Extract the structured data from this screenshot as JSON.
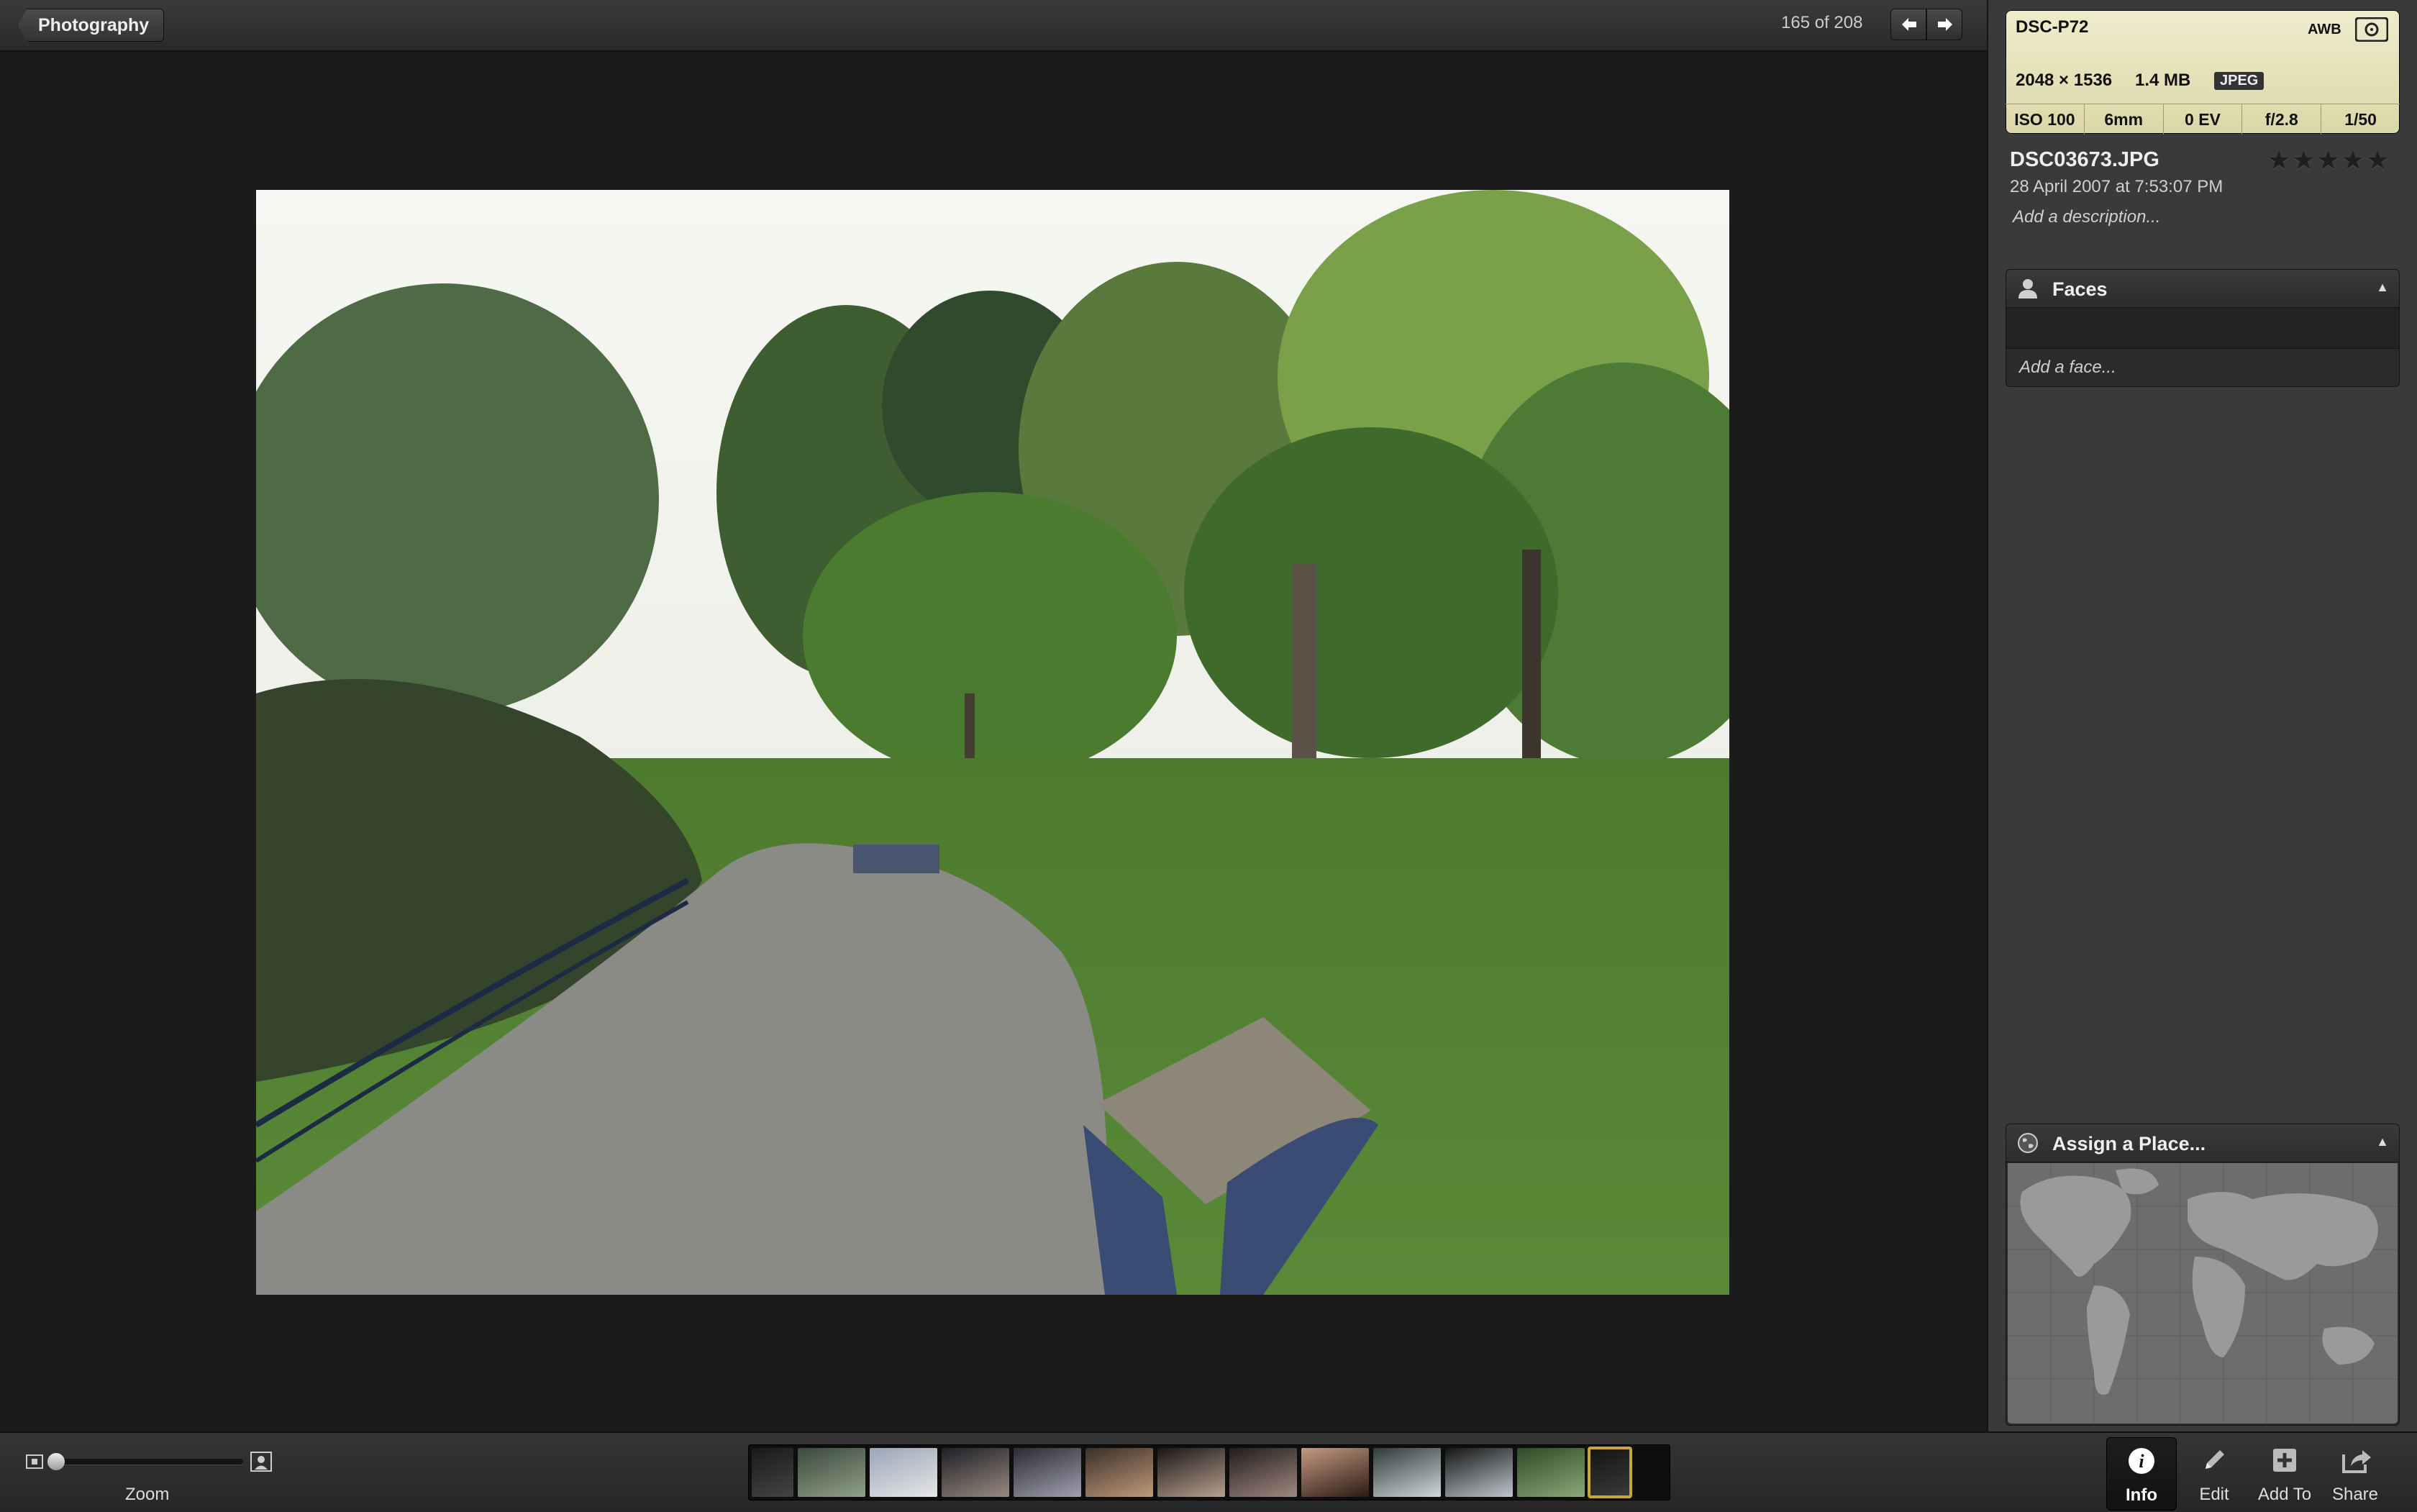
{
  "topbar": {
    "back_label": "Photography",
    "counter": "165 of 208"
  },
  "exif": {
    "camera": "DSC-P72",
    "white_balance": "AWB",
    "dimensions": "2048 × 1536",
    "file_size": "1.4 MB",
    "format": "JPEG",
    "iso": "ISO 100",
    "focal_length": "6mm",
    "exposure_bias": "0 EV",
    "aperture": "f/2.8",
    "shutter": "1/50"
  },
  "photo_info": {
    "filename": "DSC03673.JPG",
    "datetime": "28 April 2007 at 7:53:07 PM",
    "description_placeholder": "Add a description...",
    "rating": 0,
    "rating_max": 5
  },
  "faces": {
    "title": "Faces",
    "add_placeholder": "Add a face..."
  },
  "places": {
    "title": "Assign a Place..."
  },
  "bottombar": {
    "zoom_label": "Zoom",
    "zoom_level": 0,
    "thumbnail_count": 13,
    "selected_thumbnail": 12,
    "tools": {
      "info": "Info",
      "edit": "Edit",
      "add_to": "Add To",
      "share": "Share"
    }
  },
  "colors": {
    "exif_card": "#e8e4c0",
    "selection_outline": "#c9a53a",
    "panel_bg": "#3a3a3a"
  }
}
